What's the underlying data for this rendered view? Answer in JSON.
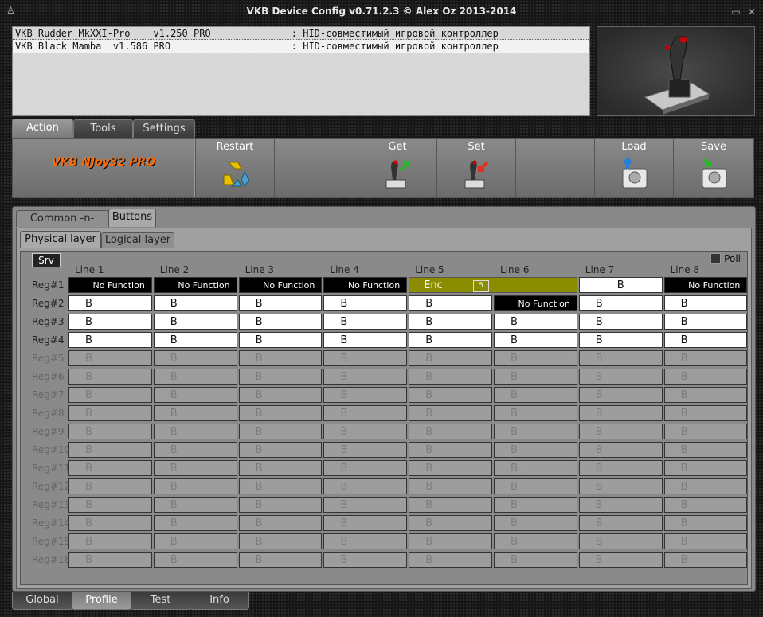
{
  "window": {
    "title": "VKB Device Config v0.71.2.3 © Alex Oz 2013-2014"
  },
  "devices": [
    {
      "text": "VKB Rudder MkXXI-Pro    v1.250 PRO              : HID-совместимый игровой контроллер",
      "selected": false
    },
    {
      "text": "VKB Black Mamba  v1.586 PRO                     : HID-совместимый игровой контроллер",
      "selected": true
    }
  ],
  "main_tabs": [
    {
      "label": "Action",
      "active": true
    },
    {
      "label": "Tools",
      "active": false
    },
    {
      "label": "Settings",
      "active": false
    }
  ],
  "toolbar": {
    "device_name": "VKB NJoy32 PRO",
    "restart": "Restart",
    "get": "Get",
    "set": "Set",
    "load": "Load",
    "save": "Save"
  },
  "content_tabs": [
    {
      "label": "Common -n- Axes",
      "active": false
    },
    {
      "label": "Buttons",
      "active": true
    }
  ],
  "layer_tabs": [
    {
      "label": "Physical layer",
      "active": true
    },
    {
      "label": "Logical layer",
      "active": false
    }
  ],
  "grid": {
    "srv_label": "Srv",
    "poll_label": "Poll",
    "columns": [
      "Line 1",
      "Line 2",
      "Line 3",
      "Line 4",
      "Line 5",
      "Line 6",
      "Line 7",
      "Line 8"
    ],
    "rows": [
      {
        "label": "Reg#1",
        "cells": [
          "No Function",
          "No Function",
          "No Function",
          "No Function",
          "Enc",
          "",
          "B",
          "No Function"
        ]
      },
      {
        "label": "Reg#2",
        "cells": [
          "B",
          "B",
          "B",
          "B",
          "B",
          "No Function",
          "B",
          "B"
        ]
      },
      {
        "label": "Reg#3",
        "cells": [
          "B",
          "B",
          "B",
          "B",
          "B",
          "B",
          "B",
          "B"
        ]
      },
      {
        "label": "Reg#4",
        "cells": [
          "B",
          "B",
          "B",
          "B",
          "B",
          "B",
          "B",
          "B"
        ]
      },
      {
        "label": "Reg#5",
        "cells": [
          "B",
          "B",
          "B",
          "B",
          "B",
          "B",
          "B",
          "B"
        ]
      },
      {
        "label": "Reg#6",
        "cells": [
          "B",
          "B",
          "B",
          "B",
          "B",
          "B",
          "B",
          "B"
        ]
      },
      {
        "label": "Reg#7",
        "cells": [
          "B",
          "B",
          "B",
          "B",
          "B",
          "B",
          "B",
          "B"
        ]
      },
      {
        "label": "Reg#8",
        "cells": [
          "B",
          "B",
          "B",
          "B",
          "B",
          "B",
          "B",
          "B"
        ]
      },
      {
        "label": "Reg#9",
        "cells": [
          "B",
          "B",
          "B",
          "B",
          "B",
          "B",
          "B",
          "B"
        ]
      },
      {
        "label": "Reg#10",
        "cells": [
          "B",
          "B",
          "B",
          "B",
          "B",
          "B",
          "B",
          "B"
        ]
      },
      {
        "label": "Reg#11",
        "cells": [
          "B",
          "B",
          "B",
          "B",
          "B",
          "B",
          "B",
          "B"
        ]
      },
      {
        "label": "Reg#12",
        "cells": [
          "B",
          "B",
          "B",
          "B",
          "B",
          "B",
          "B",
          "B"
        ]
      },
      {
        "label": "Reg#13",
        "cells": [
          "B",
          "B",
          "B",
          "B",
          "B",
          "B",
          "B",
          "B"
        ]
      },
      {
        "label": "Reg#14",
        "cells": [
          "B",
          "B",
          "B",
          "B",
          "B",
          "B",
          "B",
          "B"
        ]
      },
      {
        "label": "Reg#15",
        "cells": [
          "B",
          "B",
          "B",
          "B",
          "B",
          "B",
          "B",
          "B"
        ]
      },
      {
        "label": "Reg#16",
        "cells": [
          "B",
          "B",
          "B",
          "B",
          "B",
          "B",
          "B",
          "B"
        ]
      }
    ],
    "enabled_rows": 4,
    "encoder_badge": "5"
  },
  "bottom_tabs": [
    {
      "label": "Global",
      "active": false
    },
    {
      "label": "Profile",
      "active": true
    },
    {
      "label": "Test",
      "active": false
    },
    {
      "label": "Info",
      "active": false
    }
  ]
}
